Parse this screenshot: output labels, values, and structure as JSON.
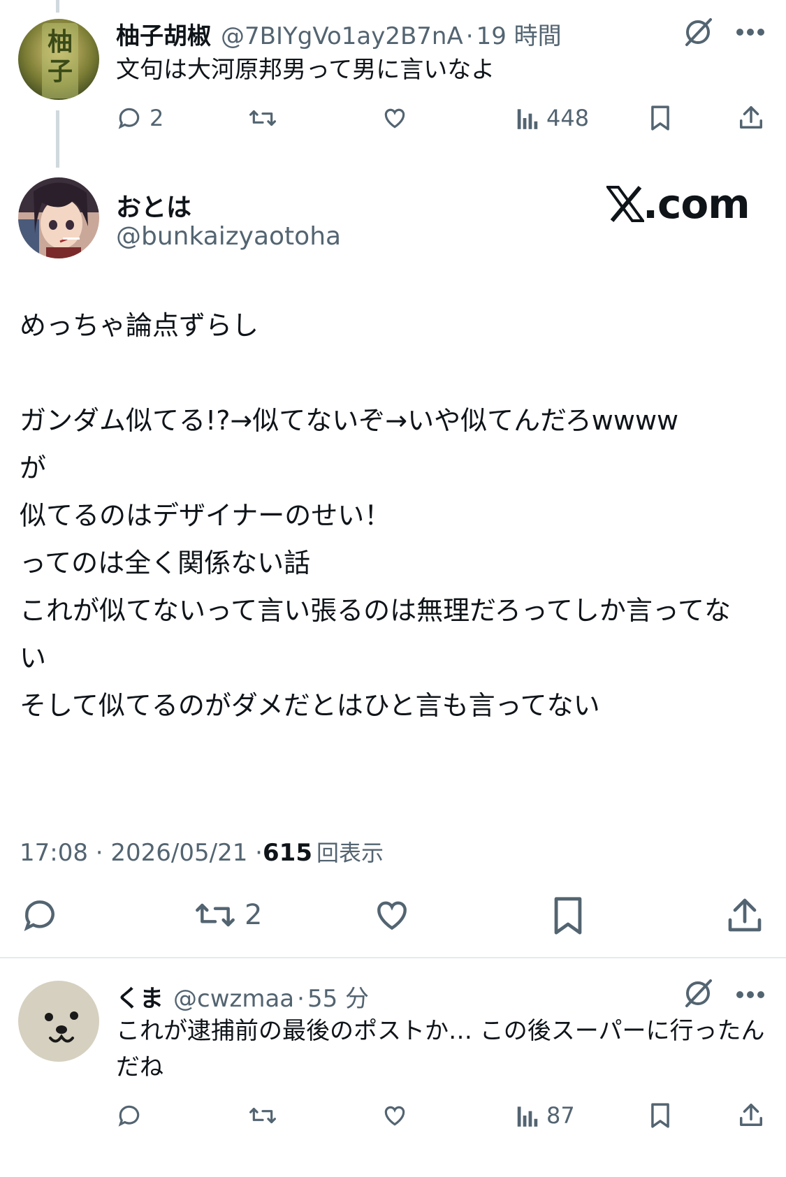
{
  "reply1": {
    "name": "柚子胡椒",
    "handle": "@7BIYgVo1ay2B7nA",
    "separator": "·",
    "time": "19 時間",
    "text": "文句は大河原邦男って男に言いなよ",
    "avatar_text": "柚子",
    "replies": "2",
    "views": "448"
  },
  "main": {
    "name": "おとは",
    "handle": "@bunkaizyaotoha",
    "brand": ".com",
    "text": "めっちゃ論点ずらし\n\nガンダム似てる!?→似てないぞ→いや似てんだろwwww\nが\n似てるのはデザイナーのせい！\nってのは全く関係ない話\nこれが似てないって言い張るのは無理だろってしか言ってない\nそして似てるのがダメだとはひと言も言ってない",
    "timestamp": "17:08 · 2026/05/21 · ",
    "view_count": "615",
    "view_label": "回表示",
    "retweets": "2"
  },
  "reply2": {
    "name": "くま",
    "handle": "@cwzmaa",
    "separator": "·",
    "time": "55 分",
    "text": "これが逮捕前の最後のポストか… この後スーパーに行ったんだね",
    "views": "87"
  },
  "colors": {
    "text": "#0f1419",
    "secondary": "#536471",
    "thread_line": "#cfd9de",
    "divider": "#e6e9ec"
  },
  "icons": [
    "grok-icon",
    "more-icon",
    "reply-icon",
    "retweet-icon",
    "like-icon",
    "views-icon",
    "bookmark-icon",
    "share-icon",
    "x-logo-icon"
  ]
}
